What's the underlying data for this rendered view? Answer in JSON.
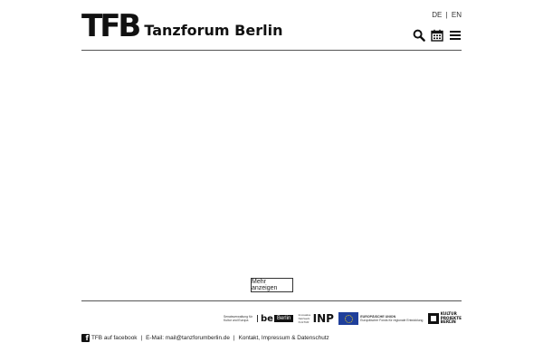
{
  "header": {
    "logo_mark": "TFB",
    "site_name": "Tanzforum Berlin",
    "lang": {
      "de": "DE",
      "sep": "|",
      "en": "EN"
    },
    "icons": [
      "search-icon",
      "calendar-icon",
      "menu-icon"
    ]
  },
  "main": {
    "more_button": "Mehr anzeigen"
  },
  "sponsors": {
    "senat": "Senatsverwaltung für Kultur und Europa",
    "be": "be",
    "berlin": "Berlin",
    "inp_small": "Innovative Netzwerk KULTUR",
    "inp": "INP",
    "eu_head": "EUROPÄISCHE UNION",
    "eu_sub": "Europäischer Fonds für regionale Entwicklung",
    "kultur_1": "KULTUR",
    "kultur_2": "PROJEKTE",
    "kultur_3": "BERLIN"
  },
  "footer": {
    "facebook": "TFB auf facebook",
    "email": "E-Mail: mail@tanzforumberlin.de",
    "contact": "Kontakt, Impressum & Datenschutz",
    "sep": "|"
  },
  "colors": {
    "text": "#111111",
    "eu_blue": "#1f3f9b",
    "eu_star": "#f2d21b"
  }
}
